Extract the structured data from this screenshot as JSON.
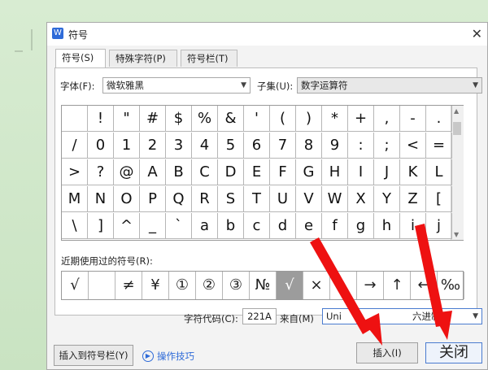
{
  "dialog": {
    "title": "符号",
    "app_icon_letter": "W",
    "close_glyph": "✕"
  },
  "tabs": [
    {
      "label": "符号(S)"
    },
    {
      "label": "特殊字符(P)"
    },
    {
      "label": "符号栏(T)"
    }
  ],
  "font": {
    "label": "字体(F):",
    "value": "微软雅黑"
  },
  "subset": {
    "label": "子集(U):",
    "value": "数字运算符"
  },
  "symbols": [
    [
      " ",
      "!",
      "\"",
      "#",
      "$",
      "%",
      "&",
      "'",
      "(",
      ")",
      "*",
      "+",
      ",",
      "-",
      "."
    ],
    [
      "/",
      "0",
      "1",
      "2",
      "3",
      "4",
      "5",
      "6",
      "7",
      "8",
      "9",
      ":",
      ";",
      "<",
      "="
    ],
    [
      ">",
      "?",
      "@",
      "A",
      "B",
      "C",
      "D",
      "E",
      "F",
      "G",
      "H",
      "I",
      "J",
      "K",
      "L"
    ],
    [
      "M",
      "N",
      "O",
      "P",
      "Q",
      "R",
      "S",
      "T",
      "U",
      "V",
      "W",
      "X",
      "Y",
      "Z",
      "["
    ],
    [
      "\\",
      "]",
      "^",
      "_",
      "`",
      "a",
      "b",
      "c",
      "d",
      "e",
      "f",
      "g",
      "h",
      "i",
      "j"
    ]
  ],
  "recent": {
    "label": "近期使用过的符号(R):",
    "items": [
      "√",
      "",
      "≠",
      "¥",
      "①",
      "②",
      "③",
      "№",
      "√",
      "×",
      "",
      "→",
      "↑",
      "←",
      "‰"
    ]
  },
  "char_code": {
    "label": "字符代码(C):",
    "value": "221A"
  },
  "from": {
    "label": "来自(M)",
    "value_left": "Uni",
    "value_right": "六进制)"
  },
  "buttons": {
    "insert_to_bar": "插入到符号栏(Y)",
    "tips": "操作技巧",
    "insert": "插入(I)",
    "close": "关闭"
  },
  "colors": {
    "accent": "#2f6bd8",
    "arrow": "#ee1111"
  }
}
